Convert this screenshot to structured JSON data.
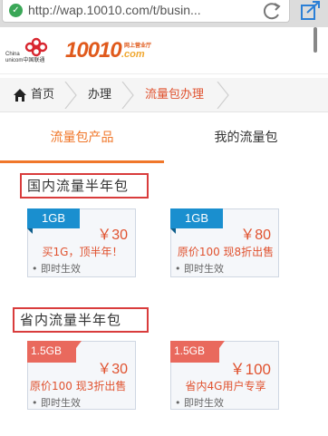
{
  "browser": {
    "url": "http://wap.10010.com/t/busin..."
  },
  "header": {
    "logo_china": "China",
    "logo_unicom": "unicom中国联通",
    "logo_number": "10010",
    "logo_com": ".com",
    "logo_sub": "网上营业厅"
  },
  "breadcrumb": {
    "home": "首页",
    "handle": "办理",
    "current": "流量包办理"
  },
  "tabs": [
    {
      "label": "流量包产品",
      "active": true
    },
    {
      "label": "我的流量包",
      "active": false
    }
  ],
  "sections": [
    {
      "title": "国内流量半年包",
      "cards": [
        {
          "badge": "1GB",
          "price": "￥30",
          "desc": "买1G，顶半年！",
          "note": "• 即时生效"
        },
        {
          "badge": "1GB",
          "price": "￥80",
          "desc": "原价100 现8折出售",
          "note": "• 即时生效"
        }
      ]
    },
    {
      "title": "省内流量半年包",
      "cards": [
        {
          "badge": "1.5GB",
          "price": "￥30",
          "desc": "原价100 现3折出售",
          "note": "• 即时生效"
        },
        {
          "badge": "1.5GB",
          "price": "￥100",
          "desc": "省内4G用户专享",
          "note": "• 即时生效"
        }
      ]
    }
  ],
  "colors": {
    "accent_orange": "#f0772a",
    "price_red": "#e0522f",
    "badge_blue": "#1a8fcf",
    "badge_red": "#e9695d",
    "section_border": "#d93c3c"
  }
}
